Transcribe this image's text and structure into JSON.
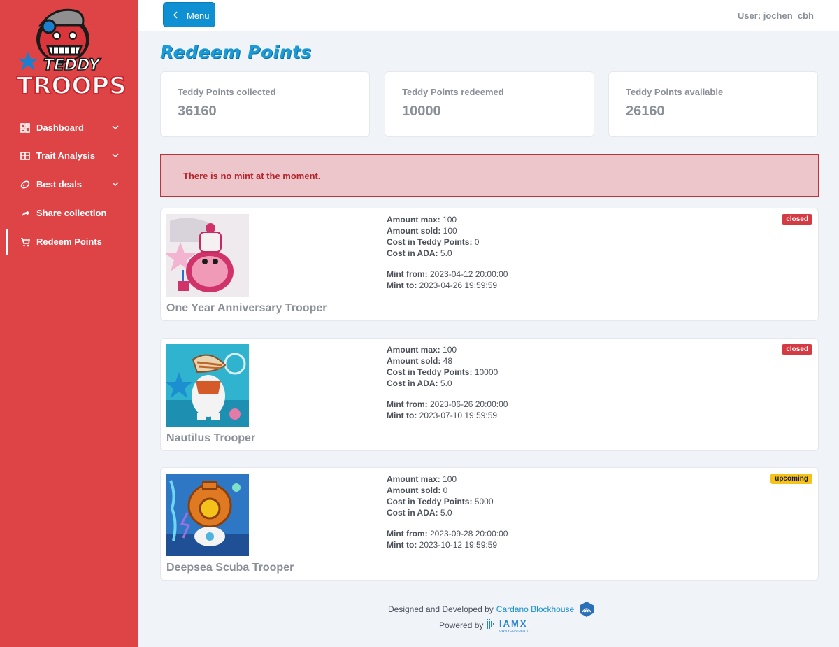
{
  "app": {
    "logo_text_top": "TEDDY",
    "logo_text_bottom": "TROOPS"
  },
  "sidebar": {
    "items": [
      {
        "label": "Dashboard",
        "icon": "dashboard-icon",
        "expandable": true
      },
      {
        "label": "Trait Analysis",
        "icon": "table-icon",
        "expandable": true
      },
      {
        "label": "Best deals",
        "icon": "deals-icon",
        "expandable": true
      },
      {
        "label": "Share collection",
        "icon": "share-icon",
        "expandable": false
      },
      {
        "label": "Redeem Points",
        "icon": "cart-icon",
        "expandable": false,
        "active": true
      }
    ]
  },
  "topbar": {
    "menu_label": "Menu",
    "user": "User: jochen_cbh"
  },
  "page": {
    "title": "Redeem Points"
  },
  "stats": [
    {
      "label": "Teddy Points collected",
      "value": "36160"
    },
    {
      "label": "Teddy Points redeemed",
      "value": "10000"
    },
    {
      "label": "Teddy Points available",
      "value": "26160"
    }
  ],
  "alert": {
    "text": "There is no mint at the moment."
  },
  "labels": {
    "amount_max": "Amount max:",
    "amount_sold": "Amount sold:",
    "cost_points": "Cost in Teddy Points:",
    "cost_ada": "Cost in ADA:",
    "mint_from": "Mint from:",
    "mint_to": "Mint to:"
  },
  "mints": [
    {
      "name": "One Year Anniversary Trooper",
      "amount_max": "100",
      "amount_sold": "100",
      "cost_points": "0",
      "cost_ada": "5.0",
      "mint_from": "2023-04-12 20:00:00",
      "mint_to": "2023-04-26 19:59:59",
      "status": "closed"
    },
    {
      "name": "Nautilus Trooper",
      "amount_max": "100",
      "amount_sold": "48",
      "cost_points": "10000",
      "cost_ada": "5.0",
      "mint_from": "2023-06-26 20:00:00",
      "mint_to": "2023-07-10 19:59:59",
      "status": "closed"
    },
    {
      "name": "Deepsea Scuba Trooper",
      "amount_max": "100",
      "amount_sold": "0",
      "cost_points": "5000",
      "cost_ada": "5.0",
      "mint_from": "2023-09-28 20:00:00",
      "mint_to": "2023-10-12 19:59:59",
      "status": "upcoming"
    }
  ],
  "footer": {
    "designed_by": "Designed and Developed by",
    "designer_link": "Cardano Blockhouse",
    "powered_by": "Powered by",
    "powered_brand": "IAMX",
    "powered_tagline": "OWN YOUR IDENTITY"
  },
  "colors": {
    "sidebar": "#de4446",
    "accent": "#0e90d2",
    "closed": "#d43c44",
    "upcoming": "#f5c21a"
  }
}
